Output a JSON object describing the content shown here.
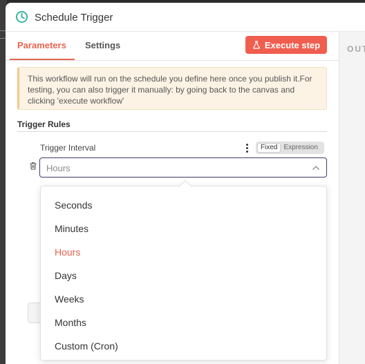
{
  "header": {
    "title": "Schedule Trigger",
    "icon": "clock-icon"
  },
  "tabs": [
    {
      "label": "Parameters",
      "active": true
    },
    {
      "label": "Settings",
      "active": false
    }
  ],
  "execute_button": {
    "label": "Execute step",
    "icon": "flask-icon"
  },
  "output_pane": {
    "label": "OUTPUT"
  },
  "notice": {
    "text": "This workflow will run on the schedule you define here once you publish it.For testing, you can also trigger it manually: by going back to the canvas and clicking 'execute workflow'"
  },
  "trigger_rules": {
    "section_title": "Trigger Rules",
    "field_label": "Trigger Interval",
    "mode_toggle": {
      "fixed": "Fixed",
      "expression": "Expression",
      "selected": "Fixed"
    },
    "select_value": "Hours"
  },
  "dropdown": {
    "options": [
      "Seconds",
      "Minutes",
      "Hours",
      "Days",
      "Weeks",
      "Months",
      "Custom (Cron)"
    ],
    "selected": "Hours"
  },
  "colors": {
    "accent": "#e8634f",
    "button": "#f05e50",
    "notice_bg": "#fdf3e5",
    "select_border": "#3c3c6b"
  }
}
